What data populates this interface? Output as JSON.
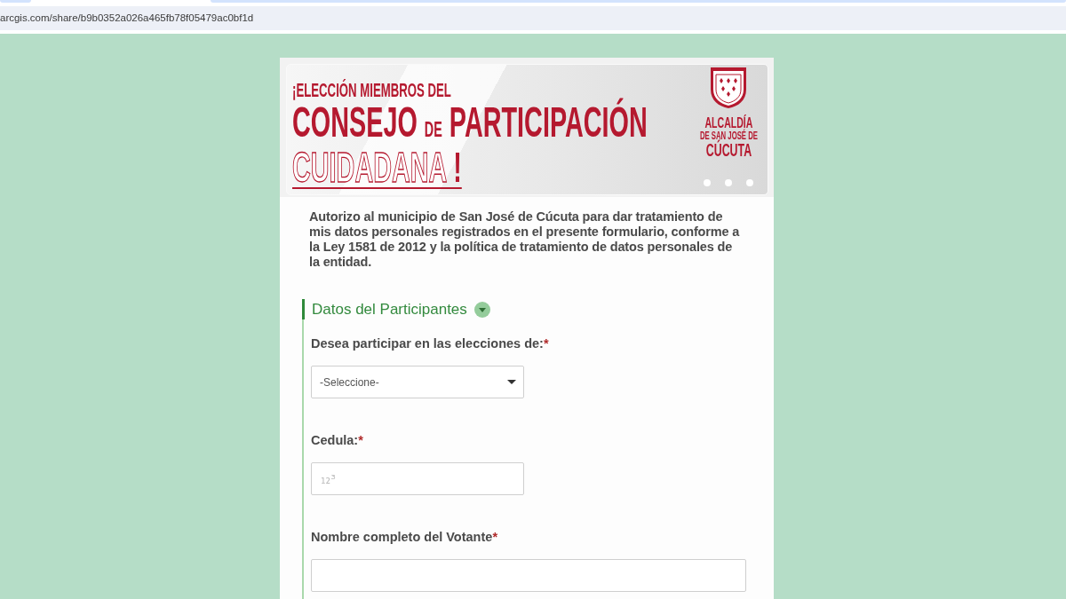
{
  "browser": {
    "url": "arcgis.com/share/b9b0352a026a465fb78f05479ac0bf1d"
  },
  "banner": {
    "headline": "¡ELECCIÓN MIEMBROS DEL",
    "title": {
      "first": "CONSEJO",
      "joiner": "DE",
      "second": "PARTICIPACIÓN"
    },
    "subtitle": {
      "outlined": "CUIDADANA",
      "mark": "!"
    },
    "logo_lines": [
      "ALCALDÍA",
      "DE SAN JOSÉ DE",
      "CÚCUTA"
    ]
  },
  "consent": "Autorizo al municipio de San José de Cúcuta para dar tratamiento de mis datos personales registrados en el presente formulario, conforme a la Ley 1581 de 2012 y la política de tratamiento de datos personales de la entidad.",
  "section": {
    "title": "Datos del Participantes",
    "expanded": true,
    "fields": [
      {
        "kind": "select",
        "label": "Desea participar en las elecciones de:",
        "required_mark": "*",
        "placeholder": "-Seleccione-"
      },
      {
        "kind": "number",
        "label": "Cedula:",
        "required_mark": "*",
        "placeholder": "₁₂³"
      },
      {
        "kind": "text",
        "label": "Nombre completo del Votante",
        "required_mark": "*"
      }
    ]
  }
}
